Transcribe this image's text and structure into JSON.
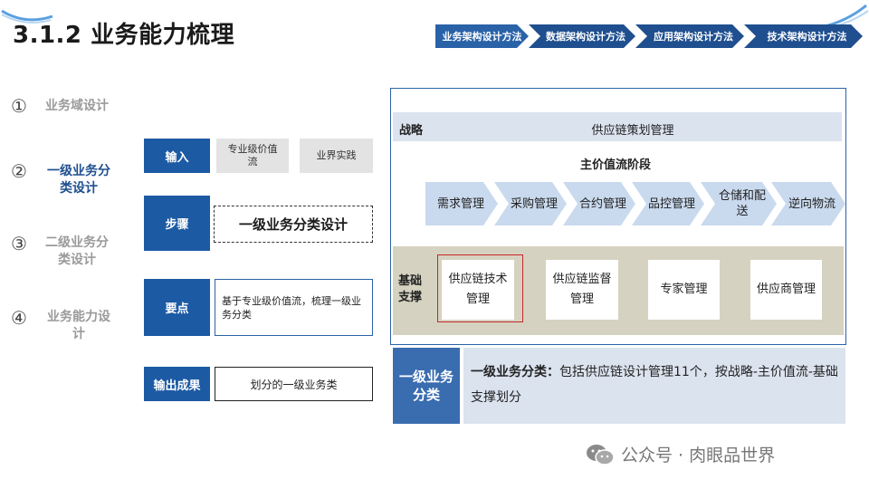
{
  "page": {
    "title": "3.1.2 业务能力梳理"
  },
  "top_chevrons": [
    "业务架构设计方法",
    "数据架构设计方法",
    "应用架构设计方法",
    "技术架构设计方法"
  ],
  "steps": [
    {
      "num": "①",
      "label_lines": [
        "业务域设计"
      ]
    },
    {
      "num": "②",
      "label_lines": [
        "一级业务分",
        "类设计"
      ]
    },
    {
      "num": "③",
      "label_lines": [
        "二级业务分",
        "类设计"
      ]
    },
    {
      "num": "④",
      "label_lines": [
        "业务能力设",
        "计"
      ]
    }
  ],
  "process": {
    "input": {
      "tag": "输入",
      "items": [
        "专业级价值流",
        "业界实践"
      ]
    },
    "step": {
      "tag": "步骤",
      "text": "一级业务分类设计"
    },
    "keypoint": {
      "tag": "要点",
      "text": "基于专业级价值流，梳理一级业务分类"
    },
    "output": {
      "tag": "输出成果",
      "text": "划分的一级业务类"
    }
  },
  "diagram": {
    "strategy_label": "战略",
    "strategy_text": "供应链策划管理",
    "value_stream_title": "主价值流阶段",
    "value_stages": [
      "需求管理",
      "采购管理",
      "合约管理",
      "品控管理",
      "仓储和配送",
      "逆向物流"
    ],
    "base_label": "基础支撑",
    "base_items": [
      "供应链技术管理",
      "供应链监督管理",
      "专家管理",
      "供应商管理"
    ]
  },
  "summary": {
    "tag": "一级业务分类",
    "lead": "一级业务分类：",
    "text": "包括供应链设计管理11个，按战略-主价值流-基础支撑划分"
  },
  "watermark": {
    "text": "公众号 · 肉眼品世界"
  },
  "colors": {
    "primary": "#1c5aa4",
    "dark_blue": "#1f4f8f",
    "light_blue": "#c9d9ee",
    "base_area": "#d6d2c1",
    "highlight_red": "#c62828"
  }
}
